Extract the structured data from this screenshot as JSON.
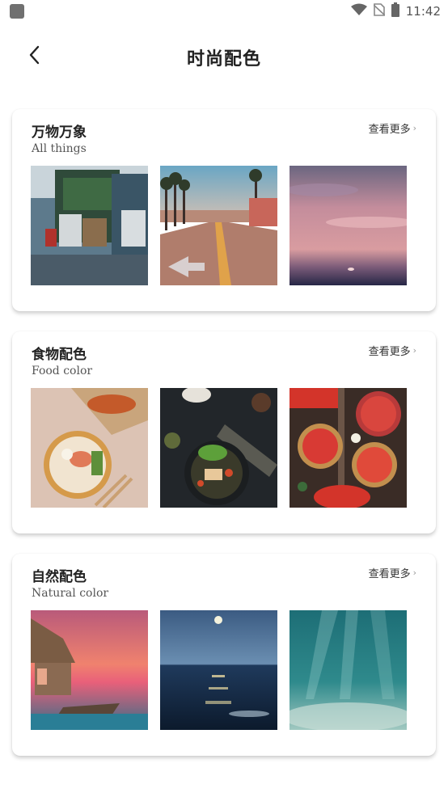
{
  "status_bar": {
    "time": "11:42",
    "icons": [
      "wifi-icon",
      "no-sim-icon",
      "battery-icon"
    ]
  },
  "header": {
    "title": "时尚配色",
    "back_icon": "chevron-left-icon"
  },
  "sections": [
    {
      "title": "万物万象",
      "subtitle": "All things",
      "more_label": "查看更多",
      "images": [
        "street-shop-photo",
        "palm-road-photo",
        "pink-sunset-sky-photo"
      ]
    },
    {
      "title": "食物配色",
      "subtitle": "Food color",
      "more_label": "查看更多",
      "images": [
        "noodle-bowl-photo",
        "stirfry-plate-photo",
        "strawberry-tarts-photo"
      ]
    },
    {
      "title": "自然配色",
      "subtitle": "Natural color",
      "more_label": "查看更多",
      "images": [
        "pink-sea-hut-photo",
        "moonlit-sea-photo",
        "underwater-rays-photo"
      ]
    }
  ]
}
